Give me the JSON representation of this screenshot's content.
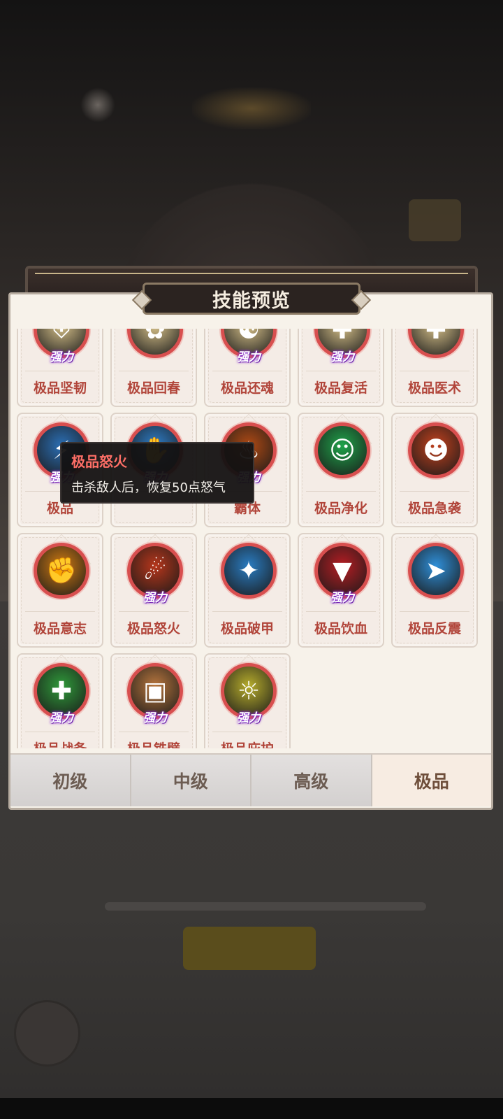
{
  "dialog": {
    "title": "技能预览"
  },
  "skills": [
    {
      "label": "极品坚韧",
      "badge": "强力",
      "icon": "shield-icon",
      "color": "#d8c28a"
    },
    {
      "label": "极品回春",
      "badge": "",
      "icon": "heal-icon",
      "color": "#d8c28a"
    },
    {
      "label": "极品还魂",
      "badge": "强力",
      "icon": "soul-icon",
      "color": "#d8c28a"
    },
    {
      "label": "极品复活",
      "badge": "强力",
      "icon": "revive-icon",
      "color": "#d8c28a"
    },
    {
      "label": "极品医术",
      "badge": "",
      "icon": "medic-icon",
      "color": "#d8c28a"
    },
    {
      "label": "极品",
      "badge": "强力",
      "icon": "lightning-man-icon",
      "color": "#2b6fb5"
    },
    {
      "label": "",
      "badge": "强力",
      "icon": "blue-hand-icon",
      "color": "#2e7ec9"
    },
    {
      "label": "霸体",
      "badge": "强力",
      "icon": "fire-warrior-icon",
      "color": "#b04a14"
    },
    {
      "label": "极品净化",
      "badge": "",
      "icon": "purify-icon",
      "color": "#1fa34a"
    },
    {
      "label": "极品急袭",
      "badge": "",
      "icon": "rage-burst-icon",
      "color": "#c2411e"
    },
    {
      "label": "极品意志",
      "badge": "",
      "icon": "fist-icon",
      "color": "#d07a12"
    },
    {
      "label": "极品怒火",
      "badge": "强力",
      "icon": "fury-icon",
      "color": "#b6361b"
    },
    {
      "label": "极品破甲",
      "badge": "",
      "icon": "armor-break-icon",
      "color": "#2a7cc1"
    },
    {
      "label": "极品饮血",
      "badge": "强力",
      "icon": "fangs-icon",
      "color": "#b51d23"
    },
    {
      "label": "极品反震",
      "badge": "",
      "icon": "rebound-icon",
      "color": "#2f8fd8"
    },
    {
      "label": "极品战备",
      "badge": "强力",
      "icon": "plus-icon",
      "color": "#2f9a3a"
    },
    {
      "label": "极品铁壁",
      "badge": "强力",
      "icon": "iron-wall-icon",
      "color": "#b9773e"
    },
    {
      "label": "极品庇护",
      "badge": "强力",
      "icon": "protect-icon",
      "color": "#b7ad2c"
    }
  ],
  "tooltip": {
    "title": "极品怒火",
    "description": "击杀敌人后，恢复50点怒气"
  },
  "tabs": [
    {
      "label": "初级",
      "active": false
    },
    {
      "label": "中级",
      "active": false
    },
    {
      "label": "高级",
      "active": false
    },
    {
      "label": "极品",
      "active": true
    }
  ]
}
